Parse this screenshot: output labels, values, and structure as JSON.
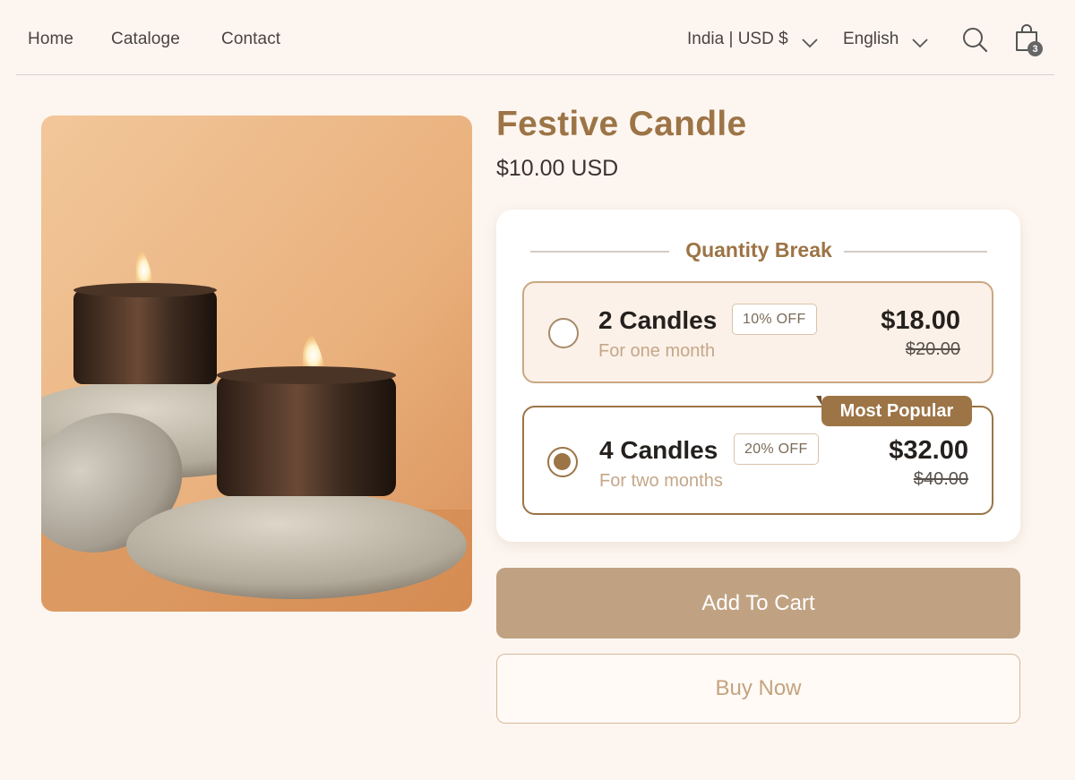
{
  "header": {
    "nav": [
      "Home",
      "Cataloge",
      "Contact"
    ],
    "region": "India | USD $",
    "language": "English",
    "cart_count": "3"
  },
  "icons": {
    "region_chevron": "chevron-down-icon",
    "language_chevron": "chevron-down-icon",
    "search": "search-icon",
    "cart": "shopping-bag-icon"
  },
  "product": {
    "title": "Festive Candle",
    "price": "$10.00 USD",
    "image": "candles-on-stones-photo"
  },
  "quantity_break": {
    "heading": "Quantity Break",
    "options": [
      {
        "title": "2 Candles",
        "badge": "10% OFF",
        "subtitle": "For one month",
        "price": "$18.00",
        "old_price": "$20.00",
        "selected": false
      },
      {
        "title": "4 Candles",
        "badge": "20% OFF",
        "subtitle": "For two months",
        "price": "$32.00",
        "old_price": "$40.00",
        "selected": true,
        "tag": "Most Popular"
      }
    ]
  },
  "actions": {
    "add_to_cart": "Add To Cart",
    "buy_now": "Buy Now"
  },
  "colors": {
    "accent": "#9c7446",
    "page_background": "#fdf6f0",
    "add_button": "#c0a282",
    "selected_option_bg": "#fcf1e8"
  }
}
